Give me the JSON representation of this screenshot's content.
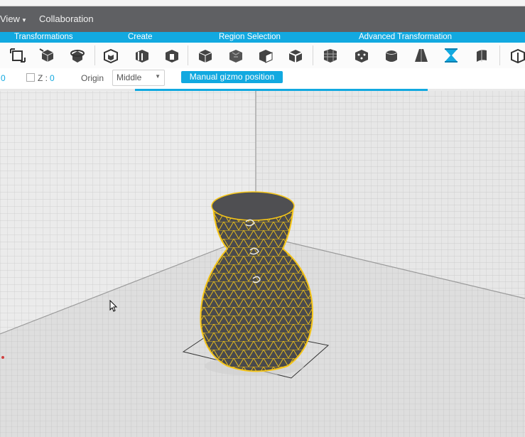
{
  "menu": {
    "view_label": "View",
    "collaboration_label": "Collaboration"
  },
  "categories": [
    "Transformations",
    "Create",
    "Region Selection",
    "Advanced Transformation"
  ],
  "toolbar_icons": [
    "move-icon",
    "rotate-icon",
    "scale-icon",
    "extrude-icon",
    "offset-icon",
    "hollow-icon",
    "select-cube-icon",
    "select-region-icon",
    "select-face-icon",
    "select-edge-icon",
    "subdivide-icon",
    "refine-icon",
    "smooth-icon",
    "taper-icon",
    "twist-icon",
    "bend-icon",
    "mirror-icon"
  ],
  "options": {
    "x_value": "0",
    "z_label": "Z :",
    "z_value": "0",
    "origin_label": "Origin",
    "origin_value": "Middle",
    "gizmo_button": "Manual gizmo position"
  },
  "colors": {
    "accent": "#12a9e0",
    "menubar": "#5f6063",
    "mesh": "#f5c518",
    "model": "#4a4a4c"
  }
}
